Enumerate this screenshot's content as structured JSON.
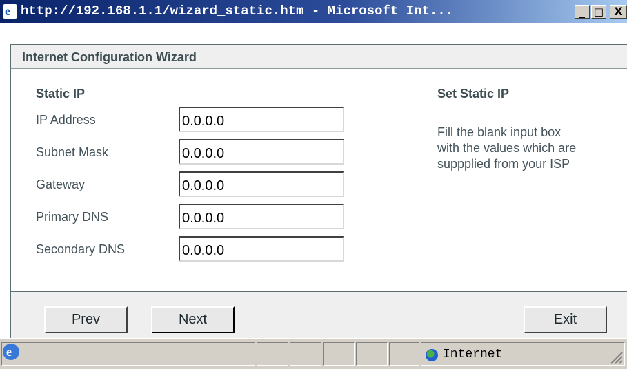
{
  "window": {
    "title": "http://192.168.1.1/wizard_static.htm - Microsoft Int...",
    "minimize": "_",
    "maximize": "□",
    "close": "X"
  },
  "wizard": {
    "header": "Internet Configuration Wizard",
    "section": "Static IP",
    "fields": [
      {
        "label": "IP Address",
        "value": "0.0.0.0"
      },
      {
        "label": "Subnet Mask",
        "value": "0.0.0.0"
      },
      {
        "label": "Gateway",
        "value": "0.0.0.0"
      },
      {
        "label": "Primary DNS",
        "value": "0.0.0.0"
      },
      {
        "label": "Secondary DNS",
        "value": "0.0.0.0"
      }
    ],
    "help_title": "Set Static IP",
    "help_lines": [
      "Fill the blank input box",
      "with the values which are",
      "suppplied from your ISP"
    ],
    "buttons": {
      "prev": "Prev",
      "next": "Next",
      "exit": "Exit"
    }
  },
  "statusbar": {
    "zone": "Internet",
    "page_icon": "ie-page-icon",
    "zone_icon": "globe-icon"
  }
}
